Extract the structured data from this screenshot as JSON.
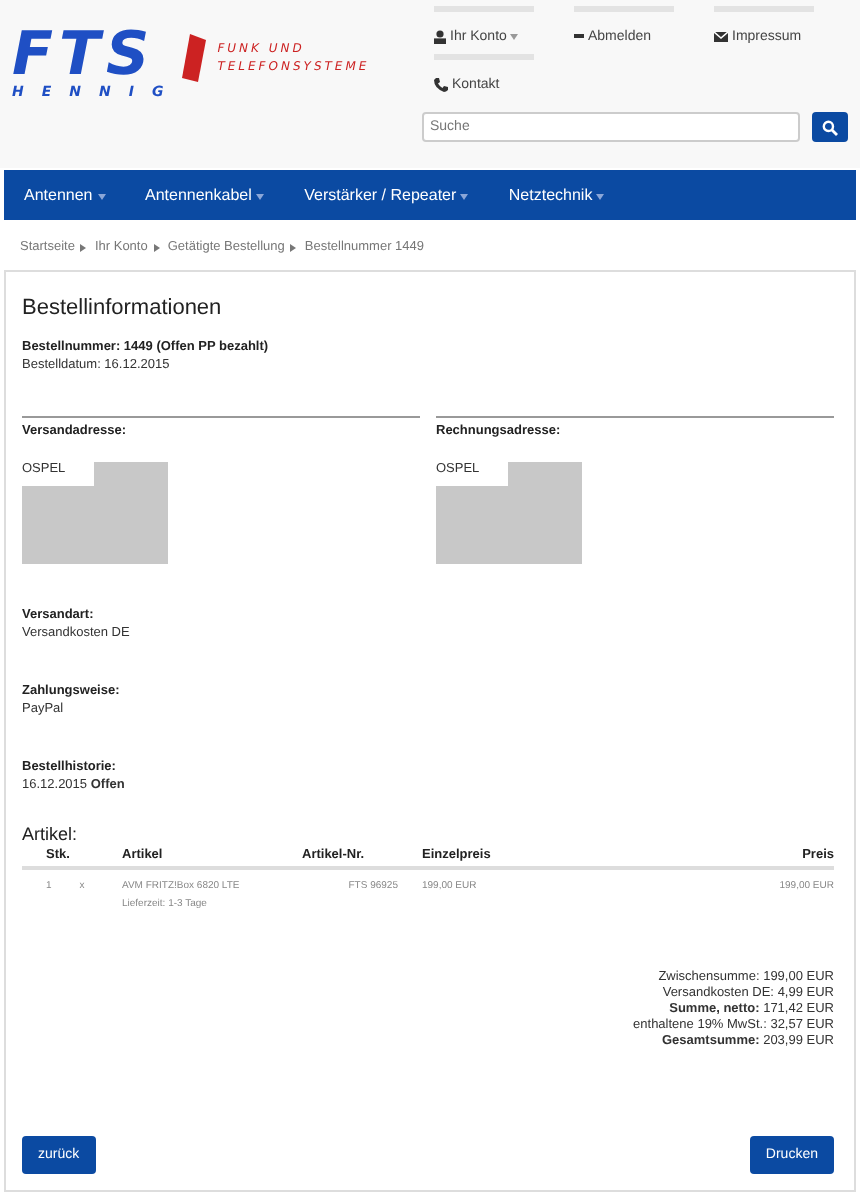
{
  "header": {
    "logo_main": "FTS",
    "logo_sub": "HENNIG",
    "logo_tagline_1": "FUNK UND",
    "logo_tagline_2": "TELEFONSYSTEME",
    "links": [
      {
        "label": "Ihr Konto",
        "dropdown": true
      },
      {
        "label": "Abmelden",
        "dropdown": false
      },
      {
        "label": "Impressum",
        "dropdown": false
      },
      {
        "label": "Kontakt",
        "dropdown": false
      }
    ],
    "search": {
      "placeholder": "Suche"
    }
  },
  "nav": [
    {
      "label": "Antennen"
    },
    {
      "label": "Antennenkabel"
    },
    {
      "label": "Verstärker / Repeater"
    },
    {
      "label": "Netztechnik"
    }
  ],
  "breadcrumb": [
    "Startseite",
    "Ihr Konto",
    "Getätigte Bestellung",
    "Bestellnummer 1449"
  ],
  "order": {
    "title": "Bestellinformationen",
    "number": "Bestellnummer: 1449 (Offen PP bezahlt)",
    "date": "Bestelldatum: 16.12.2015",
    "addresses": [
      {
        "heading": "Versandadresse:",
        "name": "OSPEL"
      },
      {
        "heading": "Rechnungsadresse:",
        "name": "OSPEL"
      }
    ],
    "sections": [
      {
        "heading": "Versandart:",
        "text": "Versandkosten DE"
      },
      {
        "heading": "Zahlungsweise:",
        "text": "PayPal"
      },
      {
        "heading": "Bestellhistorie:",
        "text": "16.12.2015 **Offen**"
      }
    ],
    "items_title": "Artikel:",
    "table": {
      "columns": [
        "Stk.",
        "Artikel",
        "Artikel-Nr.",
        "Einzelpreis",
        "Preis"
      ],
      "rows": [
        {
          "qty": "1",
          "times": "x",
          "name": "AVM FRITZ!Box 6820 LTE",
          "delivery": "Lieferzeit: 1-3 Tage",
          "sku": "FTS 96925",
          "unit_price": "199,00 EUR",
          "price": "199,00 EUR"
        }
      ]
    },
    "totals": [
      {
        "label": "Zwischensumme:",
        "value": "199,00 EUR",
        "bold": false
      },
      {
        "label": "Versandkosten DE:",
        "value": "4,99 EUR",
        "bold": false
      },
      {
        "label": "Summe, netto:",
        "value": "171,42 EUR",
        "bold": true
      },
      {
        "label": "enthaltene 19% MwSt.:",
        "value": "32,57 EUR",
        "bold": false
      },
      {
        "label": "Gesamtsumme:",
        "value": "203,99 EUR",
        "bold": true
      }
    ],
    "buttons": {
      "back": "zurück",
      "print": "Drucken"
    }
  }
}
